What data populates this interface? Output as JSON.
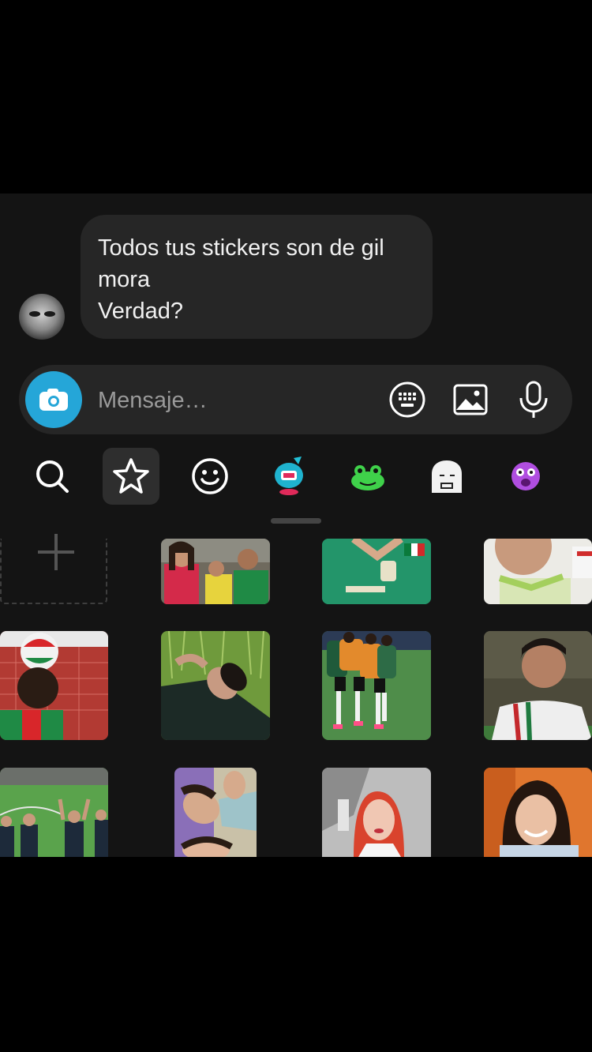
{
  "message": {
    "text": "Todos tus stickers son de gil\nmora\nVerdad?"
  },
  "composer": {
    "placeholder": "Mensaje…",
    "camera_icon": "camera-icon",
    "icons": [
      "keyboard-icon",
      "image-icon",
      "microphone-icon"
    ]
  },
  "sticker_tabs": [
    {
      "name": "search-icon",
      "active": false
    },
    {
      "name": "star-icon",
      "active": true
    },
    {
      "name": "smiley-icon",
      "active": false
    },
    {
      "name": "sticker-pack-blue-character",
      "active": false
    },
    {
      "name": "sticker-pack-green-frog",
      "active": false
    },
    {
      "name": "sticker-pack-white-ghost",
      "active": false
    },
    {
      "name": "sticker-pack-purple-face",
      "active": false
    }
  ],
  "colors": {
    "background": "#141414",
    "bubble": "#262626",
    "camera_button": "#25a6d8",
    "placeholder": "#9a9a9a"
  },
  "stickers": [
    {
      "name": "add-sticker-cell"
    },
    {
      "name": "sticker-photo-boys-jerseys"
    },
    {
      "name": "sticker-photo-green-jersey"
    },
    {
      "name": "sticker-photo-boy-closeup"
    },
    {
      "name": "sticker-photo-ball-header"
    },
    {
      "name": "sticker-photo-lying-grass"
    },
    {
      "name": "sticker-photo-team-training"
    },
    {
      "name": "sticker-photo-boy-stadium"
    },
    {
      "name": "sticker-photo-field-celebration"
    },
    {
      "name": "sticker-photo-selfie-pair"
    },
    {
      "name": "sticker-photo-redhead-girl"
    },
    {
      "name": "sticker-photo-smiling-woman"
    }
  ]
}
